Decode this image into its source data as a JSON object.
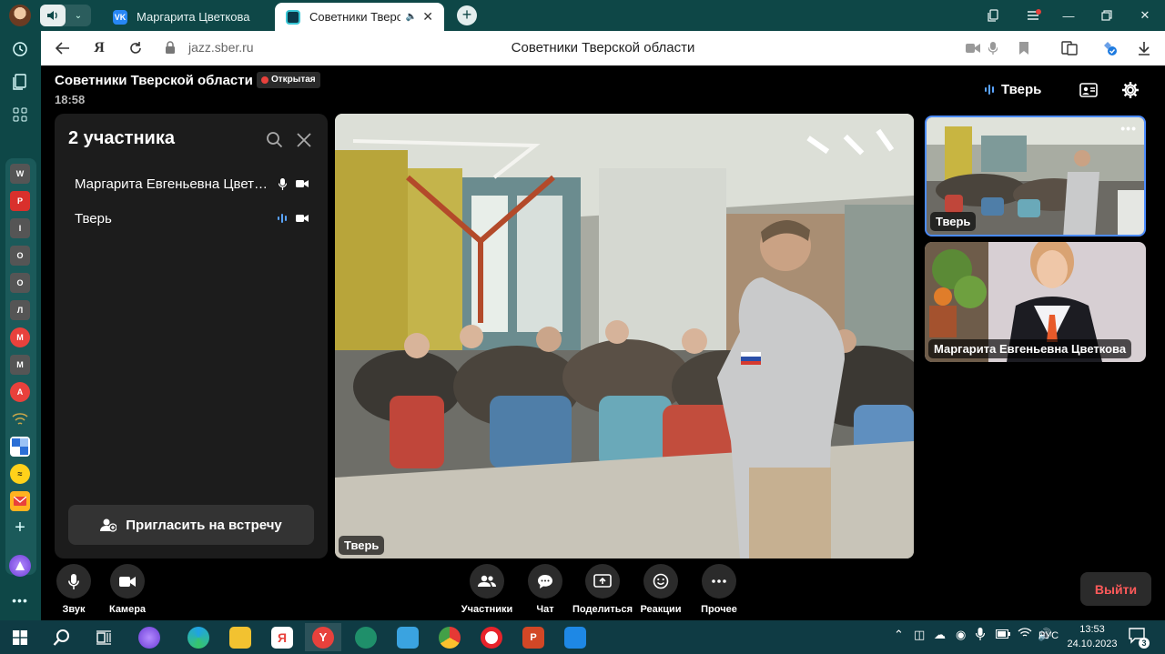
{
  "browser": {
    "tabs": [
      {
        "title": "Маргарита Цветкова",
        "favicon": "vk-icon"
      },
      {
        "title": "Советники Тверской о",
        "favicon": "sber-jazz-icon"
      }
    ],
    "url": "jazz.sber.ru",
    "page_title": "Советники Тверской области"
  },
  "sidebar_apps": [
    "W",
    "P",
    "I",
    "O",
    "O",
    "Л",
    "",
    "M",
    "",
    "",
    "",
    "",
    "",
    ""
  ],
  "meeting": {
    "title": "Советники Тверской области",
    "badge": "Открытая",
    "time": "18:58",
    "active_speaker": "Тверь"
  },
  "participants_panel": {
    "title": "2 участника",
    "items": [
      {
        "name": "Маргарита Евгеньевна Цветкова"
      },
      {
        "name": "Тверь"
      }
    ],
    "invite_label": "Пригласить на встречу"
  },
  "main_video": {
    "label": "Тверь"
  },
  "thumbnails": [
    {
      "label": "Тверь"
    },
    {
      "label": "Маргарита Евгеньевна Цветкова"
    }
  ],
  "controls": {
    "sound": "Звук",
    "camera": "Камера",
    "participants": "Участники",
    "chat": "Чат",
    "share": "Поделиться",
    "reactions": "Реакции",
    "more": "Прочее",
    "leave": "Выйти"
  },
  "taskbar": {
    "lang": "РУС",
    "time": "13:53",
    "date": "24.10.2023",
    "notifications": "3"
  },
  "colors": {
    "browser_chrome": "#0e4747",
    "accent_blue": "#4c8cff",
    "leave_red": "#ff5a5a",
    "badge_dot": "#e8413c"
  }
}
